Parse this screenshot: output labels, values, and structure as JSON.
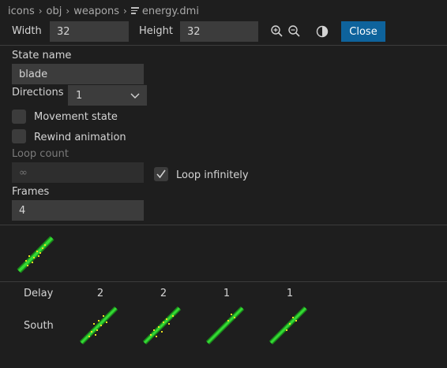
{
  "breadcrumb": {
    "items": [
      "icons",
      "obj",
      "weapons"
    ],
    "file": "energy.dmi"
  },
  "toolbar": {
    "width_label": "Width",
    "width_value": "32",
    "height_label": "Height",
    "height_value": "32",
    "zoom_in_icon": "zoom-in-icon",
    "zoom_out_icon": "zoom-out-icon",
    "contrast_icon": "contrast-icon",
    "close_label": "Close"
  },
  "state": {
    "state_name_label": "State name",
    "state_name_value": "blade",
    "directions_label": "Directions",
    "directions_value": "1",
    "movement_state_label": "Movement state",
    "movement_state_checked": false,
    "rewind_animation_label": "Rewind animation",
    "rewind_animation_checked": false,
    "loop_count_label": "Loop count",
    "loop_count_placeholder": "∞",
    "loop_infinitely_label": "Loop infinitely",
    "loop_infinitely_checked": true,
    "frames_label": "Frames",
    "frames_value": "4"
  },
  "frames_table": {
    "delay_label": "Delay",
    "direction_label": "South",
    "delays": [
      "2",
      "2",
      "1",
      "1"
    ]
  },
  "colors": {
    "accent": "#0e639c",
    "background": "#1e1e1e",
    "input": "#3c3c3c",
    "blade_green": "#2ecc2e",
    "spark_yellow": "#e8e020"
  }
}
